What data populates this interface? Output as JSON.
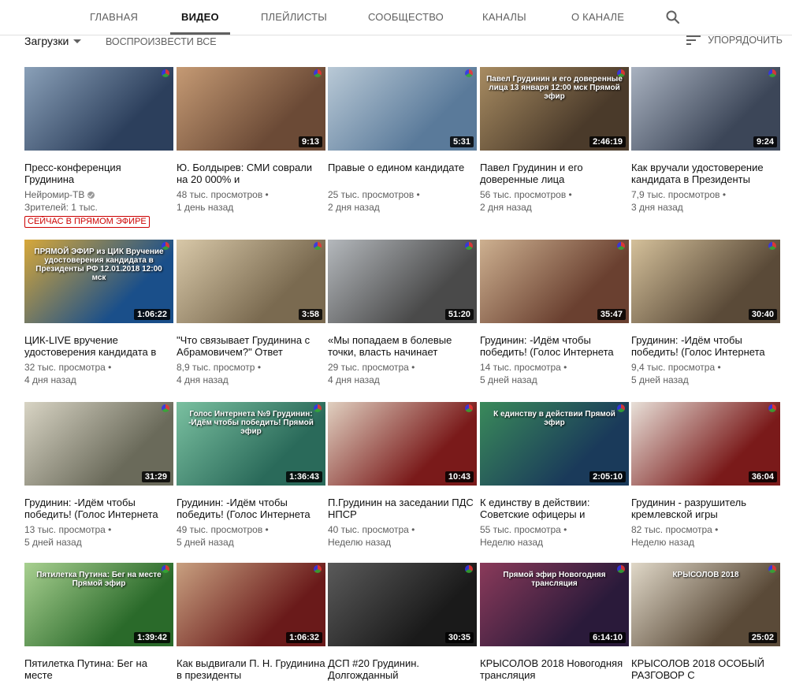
{
  "tabs": [
    {
      "label": "ГЛАВНАЯ",
      "active": false
    },
    {
      "label": "ВИДЕО",
      "active": true
    },
    {
      "label": "ПЛЕЙЛИСТЫ",
      "active": false
    },
    {
      "label": "СООБЩЕСТВО",
      "active": false
    },
    {
      "label": "КАНАЛЫ",
      "active": false
    },
    {
      "label": "О КАНАЛЕ",
      "active": false
    }
  ],
  "controls": {
    "uploads_label": "Загрузки",
    "play_all_label": "ВОСПРОИЗВЕСТИ ВСЕ",
    "sort_label": "УПОРЯДОЧИТЬ"
  },
  "featured": {
    "channel": "Нейромир-ТВ",
    "viewers": "Зрителей: 1 тыс.",
    "live_badge": "СЕЙЧАС В ПРЯМОМ ЭФИРЕ"
  },
  "videos": [
    {
      "title": "Пресс-конференция Грудинина",
      "duration": "",
      "views": "",
      "age": "",
      "thumb": [
        "#2c3f5c",
        "#8aa0b8"
      ]
    },
    {
      "title": "Ю. Болдырев: СМИ соврали на 20 000% и",
      "duration": "9:13",
      "views": "48 тыс. просмотров",
      "age": "1 день назад",
      "thumb": [
        "#6b4a36",
        "#c59a74"
      ]
    },
    {
      "title": "Правые о едином кандидате",
      "duration": "5:31",
      "views": "25 тыс. просмотров",
      "age": "2 дня назад",
      "thumb": [
        "#5a7a9a",
        "#b9c9d6"
      ]
    },
    {
      "title": "Павел Грудинин и его доверенные лица",
      "duration": "2:46:19",
      "views": "56 тыс. просмотров",
      "age": "2 дня назад",
      "thumb": [
        "#4a3a2a",
        "#a88c62"
      ],
      "overlay": "Павел Грудинин и его доверенные лица 13 января 12:00 мск Прямой эфир"
    },
    {
      "title": "Как вручали удостоверение кандидата в Президенты",
      "duration": "9:24",
      "views": "7,9 тыс. просмотров",
      "age": "3 дня назад",
      "thumb": [
        "#3c4658",
        "#a9b2c0"
      ]
    },
    {
      "title": "ЦИК-LIVE вручение удостоверения кандидата в",
      "duration": "1:06:22",
      "views": "32 тыс. просмотра",
      "age": "4 дня назад",
      "thumb": [
        "#1a4f8a",
        "#d7a83a"
      ],
      "overlay": "ПРЯМОЙ ЭФИР из ЦИК Вручение удостоверения кандидата в Президенты РФ 12.01.2018 12:00 мск"
    },
    {
      "title": "\"Что связывает Грудинина с Абрамовичем?\" Ответ",
      "duration": "3:58",
      "views": "8,9 тыс. просмотр",
      "age": "4 дня назад",
      "thumb": [
        "#7a6a50",
        "#d8c8a8"
      ]
    },
    {
      "title": "«Мы попадаем в болевые точки, власть начинает",
      "duration": "51:20",
      "views": "29 тыс. просмотра",
      "age": "4 дня назад",
      "thumb": [
        "#4a4a4a",
        "#b4b8bc"
      ]
    },
    {
      "title": "Грудинин: -Идём чтобы победить! (Голос Интернета",
      "duration": "35:47",
      "views": "14 тыс. просмотра",
      "age": "5 дней назад",
      "thumb": [
        "#6a4030",
        "#cdb090"
      ]
    },
    {
      "title": "Грудинин: -Идём чтобы победить! (Голос Интернета",
      "duration": "30:40",
      "views": "9,4 тыс. просмотра",
      "age": "5 дней назад",
      "thumb": [
        "#5a4a38",
        "#d4c09a"
      ]
    },
    {
      "title": "Грудинин: -Идём чтобы победить! (Голос Интернета",
      "duration": "31:29",
      "views": "13 тыс. просмотра",
      "age": "5 дней назад",
      "thumb": [
        "#6a6a5a",
        "#d8d4c4"
      ]
    },
    {
      "title": "Грудинин: -Идём чтобы победить! (Голос Интернета",
      "duration": "1:36:43",
      "views": "49 тыс. просмотров",
      "age": "5 дней назад",
      "thumb": [
        "#2a6a5a",
        "#7ac0a0"
      ],
      "overlay": "Голос Интернета №9 Грудинин: -Идём чтобы победить! Прямой эфир"
    },
    {
      "title": "П.Грудинин на заседании ПДС НПСР",
      "duration": "10:43",
      "views": "40 тыс. просмотра",
      "age": "Неделю назад",
      "thumb": [
        "#7a1a1a",
        "#e0d0c0"
      ]
    },
    {
      "title": "К единству в действии: Советские офицеры и",
      "duration": "2:05:10",
      "views": "55 тыс. просмотра",
      "age": "Неделю назад",
      "thumb": [
        "#1a3a5a",
        "#3a8a5a"
      ],
      "overlay": "К единству в действии Прямой эфир"
    },
    {
      "title": "Грудинин - разрушитель кремлевской игры",
      "duration": "36:04",
      "views": "82 тыс. просмотра",
      "age": "Неделю назад",
      "thumb": [
        "#7a1a1a",
        "#e8e0d8"
      ]
    },
    {
      "title": "Пятилетка Путина: Бег на месте",
      "duration": "1:39:42",
      "views": "",
      "age": "",
      "thumb": [
        "#2a6a2a",
        "#a8d090"
      ],
      "overlay": "Пятилетка Путина: Бег на месте Прямой эфир"
    },
    {
      "title": "Как выдвигали П. Н. Грудинина в президенты",
      "duration": "1:06:32",
      "views": "",
      "age": "",
      "thumb": [
        "#6a1a1a",
        "#c8a080"
      ]
    },
    {
      "title": "ДСП #20 Грудинин. Долгожданный",
      "duration": "30:35",
      "views": "",
      "age": "",
      "thumb": [
        "#1a1a1a",
        "#5a5a5a"
      ]
    },
    {
      "title": "КРЫСОЛОВ 2018 Новогодняя трансляция",
      "duration": "6:14:10",
      "views": "",
      "age": "",
      "thumb": [
        "#2a1a3a",
        "#8a3a5a"
      ],
      "overlay": "Прямой эфир Новогодняя трансляция"
    },
    {
      "title": "КРЫСОЛОВ 2018 ОСОБЫЙ РАЗГОВОР С",
      "duration": "25:02",
      "views": "",
      "age": "",
      "thumb": [
        "#5a4a38",
        "#e0d8c8"
      ],
      "overlay": "КРЫСОЛОВ 2018"
    }
  ]
}
